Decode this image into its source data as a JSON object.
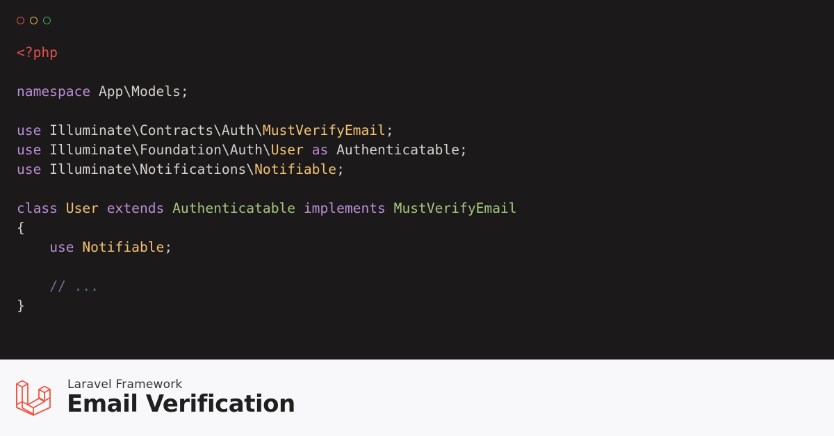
{
  "window_controls": [
    {
      "name": "close",
      "color": "#e8504e"
    },
    {
      "name": "minimize",
      "color": "#e8b84e"
    },
    {
      "name": "maximize",
      "color": "#3fae5a"
    }
  ],
  "code_lines": [
    [
      {
        "t": "tag",
        "v": "<?php"
      }
    ],
    [],
    [
      {
        "t": "kw",
        "v": "namespace"
      },
      {
        "t": "plain",
        "v": " App\\Models;"
      }
    ],
    [],
    [
      {
        "t": "kw",
        "v": "use"
      },
      {
        "t": "plain",
        "v": " Illuminate\\Contracts\\Auth\\"
      },
      {
        "t": "cls",
        "v": "MustVerifyEmail"
      },
      {
        "t": "plain",
        "v": ";"
      }
    ],
    [
      {
        "t": "kw",
        "v": "use"
      },
      {
        "t": "plain",
        "v": " Illuminate\\Foundation\\Auth\\"
      },
      {
        "t": "cls",
        "v": "User"
      },
      {
        "t": "plain",
        "v": " "
      },
      {
        "t": "kw",
        "v": "as"
      },
      {
        "t": "plain",
        "v": " Authenticatable;"
      }
    ],
    [
      {
        "t": "kw",
        "v": "use"
      },
      {
        "t": "plain",
        "v": " Illuminate\\Notifications\\"
      },
      {
        "t": "cls",
        "v": "Notifiable"
      },
      {
        "t": "plain",
        "v": ";"
      }
    ],
    [],
    [
      {
        "t": "kw",
        "v": "class"
      },
      {
        "t": "plain",
        "v": " "
      },
      {
        "t": "cls",
        "v": "User"
      },
      {
        "t": "plain",
        "v": " "
      },
      {
        "t": "kw",
        "v": "extends"
      },
      {
        "t": "plain",
        "v": " "
      },
      {
        "t": "type",
        "v": "Authenticatable"
      },
      {
        "t": "plain",
        "v": " "
      },
      {
        "t": "kw",
        "v": "implements"
      },
      {
        "t": "plain",
        "v": " "
      },
      {
        "t": "type",
        "v": "MustVerifyEmail"
      }
    ],
    [
      {
        "t": "plain",
        "v": "{"
      }
    ],
    [
      {
        "t": "plain",
        "v": "    "
      },
      {
        "t": "kw",
        "v": "use"
      },
      {
        "t": "plain",
        "v": " "
      },
      {
        "t": "cls",
        "v": "Notifiable"
      },
      {
        "t": "plain",
        "v": ";"
      }
    ],
    [],
    [
      {
        "t": "plain",
        "v": "    "
      },
      {
        "t": "comment",
        "v": "// ..."
      }
    ],
    [
      {
        "t": "plain",
        "v": "}"
      }
    ]
  ],
  "footer": {
    "subtitle": "Laravel Framework",
    "title": "Email Verification",
    "logo_icon": "laravel-logo-icon",
    "logo_color": "#f05340"
  }
}
